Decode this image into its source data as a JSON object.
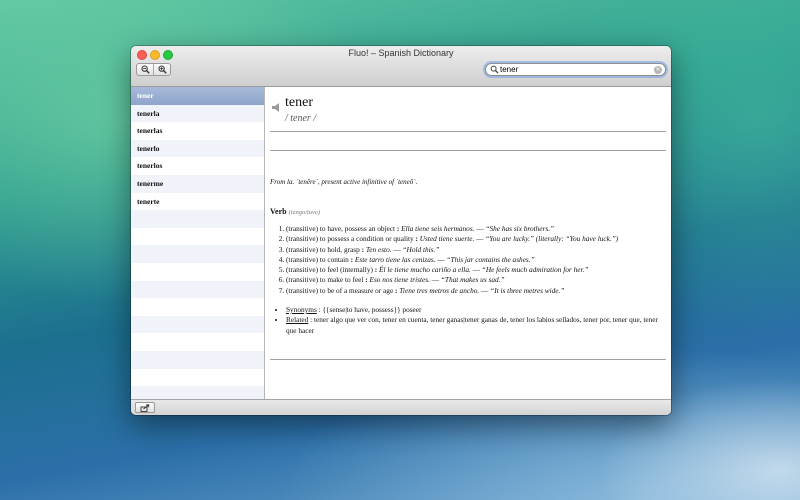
{
  "window": {
    "title": "Fluo! – Spanish Dictionary"
  },
  "toolbar": {
    "zoom_out_icon": "zoom-out-icon",
    "zoom_in_icon": "zoom-in-icon",
    "search": {
      "value": "tener",
      "placeholder": "",
      "icon": "search-icon"
    }
  },
  "sidebar": {
    "items": [
      {
        "label": "tener"
      },
      {
        "label": "tenerla"
      },
      {
        "label": "tenerlas"
      },
      {
        "label": "tenerlo"
      },
      {
        "label": "tenerlos"
      },
      {
        "label": "tenerme"
      },
      {
        "label": "tenerte"
      }
    ],
    "selected_index": 0
  },
  "entry": {
    "headword": "tener",
    "pronunciation": "/ tener /",
    "etymology": "From la. `tenēre`, present active infinitive of `teneō`.",
    "part_of_speech": "Verb",
    "pos_note": "(tengo/tuve)",
    "senses": [
      {
        "def": "(transitive) to have, possess an object",
        "sep": " : ",
        "ex": "Ella tiene seis hermanos.",
        "dash": " — ",
        "tr": "“She has six brothers.”"
      },
      {
        "def": "(transitive) to possess a condition or quality",
        "sep": " : ",
        "ex": "Usted tiene suerte.",
        "dash": " — ",
        "tr": "“You are lucky.” (literally: “You have luck.”)"
      },
      {
        "def": "(transitive) to hold, grasp",
        "sep": " : ",
        "ex": "Ten esto.",
        "dash": " — ",
        "tr": "“Hold this.”"
      },
      {
        "def": "(transitive) to contain",
        "sep": " : ",
        "ex": "Este tarro tiene las cenizas.",
        "dash": " — ",
        "tr": "“This jar contains the ashes.”"
      },
      {
        "def": "(transitive) to feel (internally)",
        "sep": " : ",
        "ex": "Él le tiene mucho cariño a ella.",
        "dash": " — ",
        "tr": "“He feels much admiration for her.”"
      },
      {
        "def": "(transitive) to make to feel",
        "sep": " : ",
        "ex": "Eso nos tiene tristes.",
        "dash": " — ",
        "tr": "“That makes us sad.”"
      },
      {
        "def": "(transitive) to be of a measure or age",
        "sep": " : ",
        "ex": "Tiene tres metros de ancho.",
        "dash": " — ",
        "tr": "“It is three metres wide.”"
      }
    ],
    "synonyms_label": "Synonyms",
    "synonyms_text": " : {{sense|to have, possess}} poseer",
    "related_label": "Related",
    "related_text": " : tener algo que ver con, tener en cuenta, tener ganas|tener ganas de, tener los labios sellados, tener por, tener que, tener que hacer"
  },
  "bottombar": {
    "share_icon": "share-icon"
  }
}
